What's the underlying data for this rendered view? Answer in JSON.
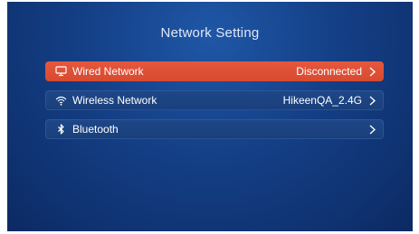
{
  "page": {
    "title": "Network Setting"
  },
  "menu": {
    "items": [
      {
        "label": "Wired Network",
        "value": "Disconnected",
        "icon": "monitor-icon",
        "selected": true
      },
      {
        "label": "Wireless Network",
        "value": "HikeenQA_2.4G",
        "icon": "wifi-icon",
        "selected": false
      },
      {
        "label": "Bluetooth",
        "value": "",
        "icon": "bluetooth-icon",
        "selected": false
      }
    ]
  },
  "colors": {
    "background": "#143f86",
    "selected_item": "#e5583d",
    "normal_item": "#1e4788",
    "text": "#ffffff"
  }
}
